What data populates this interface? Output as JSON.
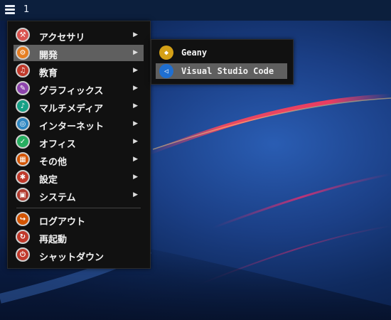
{
  "taskbar": {
    "workspace_number": "1",
    "menu_icon": "menu-icon"
  },
  "main_menu": {
    "items": [
      {
        "label": "アクセサリ",
        "icon": "accessories-icon",
        "color": "#d9534f",
        "has_submenu": true
      },
      {
        "label": "開発",
        "icon": "development-icon",
        "color": "#e67e22",
        "has_submenu": true,
        "selected": true
      },
      {
        "label": "教育",
        "icon": "education-icon",
        "color": "#c0392b",
        "has_submenu": true
      },
      {
        "label": "グラフィックス",
        "icon": "graphics-icon",
        "color": "#8e44ad",
        "has_submenu": true
      },
      {
        "label": "マルチメディア",
        "icon": "multimedia-icon",
        "color": "#16a085",
        "has_submenu": true
      },
      {
        "label": "インターネット",
        "icon": "internet-icon",
        "color": "#2e86c1",
        "has_submenu": true
      },
      {
        "label": "オフィス",
        "icon": "office-icon",
        "color": "#27ae60",
        "has_submenu": true
      },
      {
        "label": "その他",
        "icon": "other-icon",
        "color": "#d35400",
        "has_submenu": true
      },
      {
        "label": "設定",
        "icon": "settings-icon",
        "color": "#c0392b",
        "has_submenu": true
      },
      {
        "label": "システム",
        "icon": "system-icon",
        "color": "#b03a2e",
        "has_submenu": true
      }
    ],
    "actions": [
      {
        "label": "ログアウト",
        "icon": "logout-icon",
        "color": "#d35400"
      },
      {
        "label": "再起動",
        "icon": "restart-icon",
        "color": "#c0392b"
      },
      {
        "label": "シャットダウン",
        "icon": "shutdown-icon",
        "color": "#c0392b"
      }
    ],
    "arrow": "▶"
  },
  "submenu": {
    "items": [
      {
        "label": "Geany",
        "icon": "geany-icon",
        "color": "#d4a017"
      },
      {
        "label": "Visual Studio Code",
        "icon": "vscode-icon",
        "color": "#1f6fd1",
        "selected": true
      }
    ]
  }
}
